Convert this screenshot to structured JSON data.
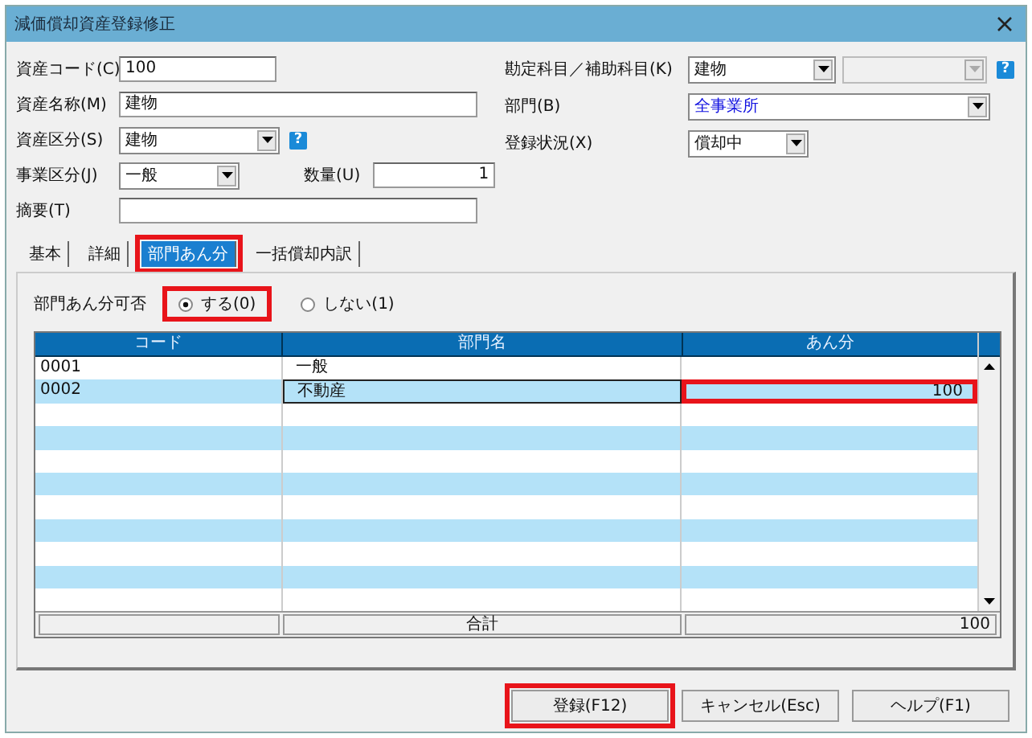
{
  "window": {
    "title": "減価償却資産登録修正"
  },
  "left_rows": [
    {
      "fields": [
        {
          "label": "資産コード(C)",
          "value": "100",
          "kind": "text"
        }
      ]
    },
    {
      "fields": [
        {
          "label": "資産名称(M)",
          "value": "建物",
          "kind": "text"
        }
      ]
    },
    {
      "fields": [
        {
          "label": "資産区分(S)",
          "value": "建物",
          "kind": "select",
          "help": "?"
        }
      ]
    },
    {
      "fields": [
        {
          "label": "事業区分(J)",
          "value": "一般",
          "kind": "select"
        },
        {
          "label": "数量(U)",
          "value": "1",
          "kind": "number"
        }
      ]
    },
    {
      "fields": [
        {
          "label": "摘要(T)",
          "kind": "text"
        }
      ]
    }
  ],
  "right_rows": [
    {
      "label": "勘定科目／補助科目(K)",
      "value": "建物",
      "kind": "select-pair",
      "emphasis": false,
      "help": "?"
    },
    {
      "label": "部門(B)",
      "value": "全事業所",
      "kind": "select-wide",
      "emphasis": true
    },
    {
      "label": "登録状況(X)",
      "value": "償却中",
      "kind": "select",
      "emphasis": false
    }
  ],
  "tabs": [
    {
      "label": "基本",
      "selected": false,
      "highlighted": false
    },
    {
      "label": "詳細",
      "selected": false,
      "highlighted": false
    },
    {
      "label": "部門あん分",
      "selected": true,
      "highlighted": true
    },
    {
      "label": "一括償却内訳",
      "selected": false,
      "highlighted": false
    }
  ],
  "allocation": {
    "label": "部門あん分可否",
    "options": [
      {
        "label": "する(0)",
        "selected": true,
        "highlighted": true
      },
      {
        "label": "しない(1)",
        "selected": false,
        "highlighted": false
      }
    ]
  },
  "grid": {
    "columns": [
      "コード",
      "部門名",
      "あん分"
    ],
    "rows": [
      {
        "code": "0001",
        "name": "一般",
        "focused": false,
        "highlighted": false
      },
      {
        "code": "0002",
        "name": "不動産",
        "share": "100",
        "focused": true,
        "highlighted": true
      }
    ],
    "total_label": "合計",
    "total": "100"
  },
  "buttons": [
    {
      "label": "登録(F12)",
      "highlighted": true
    },
    {
      "label": "キャンセル(Esc)",
      "highlighted": false
    },
    {
      "label": "ヘルプ(F1)",
      "highlighted": false
    }
  ]
}
